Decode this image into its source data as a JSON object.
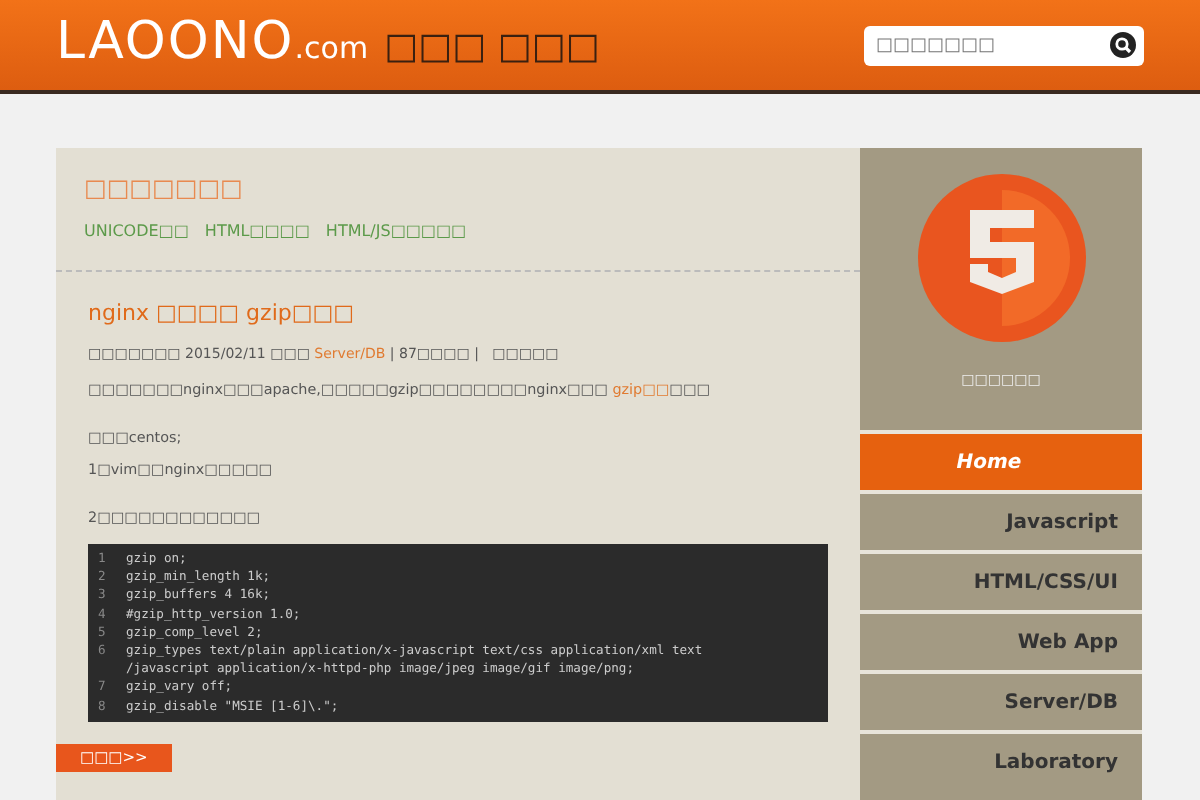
{
  "header": {
    "logo": "LAOONO",
    "logo_suffix": ".com",
    "tagline": "□□□ □□□",
    "search": {
      "placeholder": "□□□□□□□"
    }
  },
  "featured": {
    "title": "□□□□□□□",
    "links": [
      "UNICODE□□",
      "HTML□□□□",
      "HTML/JS□□□□□"
    ]
  },
  "post": {
    "title": "nginx □□□□ gzip□□□",
    "meta": {
      "author": "□□□□□□□",
      "date": "2015/02/11",
      "category_label": "□□□",
      "category": "Server/DB",
      "separators": [
        "|",
        "|"
      ],
      "views": "87□□□□",
      "comments": "□□□□□"
    },
    "paragraphs": [
      [
        "□□□□□□□nginx□□□apache,□□□□□gzip□□□□□□□□nginx□□□ ",
        {
          "link": "gzip□□"
        },
        "□□□"
      ],
      [
        "□□□centos;"
      ],
      [
        "1□vim□□nginx□□□□□"
      ],
      [
        "2□□□□□□□□□□□□"
      ]
    ],
    "code": [
      {
        "number": "1",
        "line": "gzip on;"
      },
      {
        "number": "2",
        "line": "gzip_min_length 1k;"
      },
      {
        "number": "3",
        "line": "gzip_buffers 4 16k;"
      },
      {
        "number": "4",
        "line": "#gzip_http_version 1.0;"
      },
      {
        "number": "5",
        "line": "gzip_comp_level 2;"
      },
      {
        "number": "6",
        "line": "gzip_types text/plain application/x-javascript text/css application/xml text"
      },
      {
        "line": "/javascript application/x-httpd-php image/jpeg image/gif image/png;"
      },
      {
        "number": "7",
        "line": "gzip_vary off;"
      },
      {
        "number": "8",
        "line": "gzip_disable \"MSIE [1-6]\\.\";"
      }
    ],
    "read_more": "□□□>>"
  },
  "sidebar": {
    "caption": "□□□□□□",
    "nav": [
      {
        "label": "Home",
        "selected": true
      },
      {
        "label": "Javascript",
        "selected": false
      },
      {
        "label": "HTML/CSS/UI",
        "selected": false
      },
      {
        "label": "Web App",
        "selected": false
      },
      {
        "label": "Server/DB",
        "selected": false
      },
      {
        "label": "Laboratory",
        "selected": false
      }
    ]
  }
}
